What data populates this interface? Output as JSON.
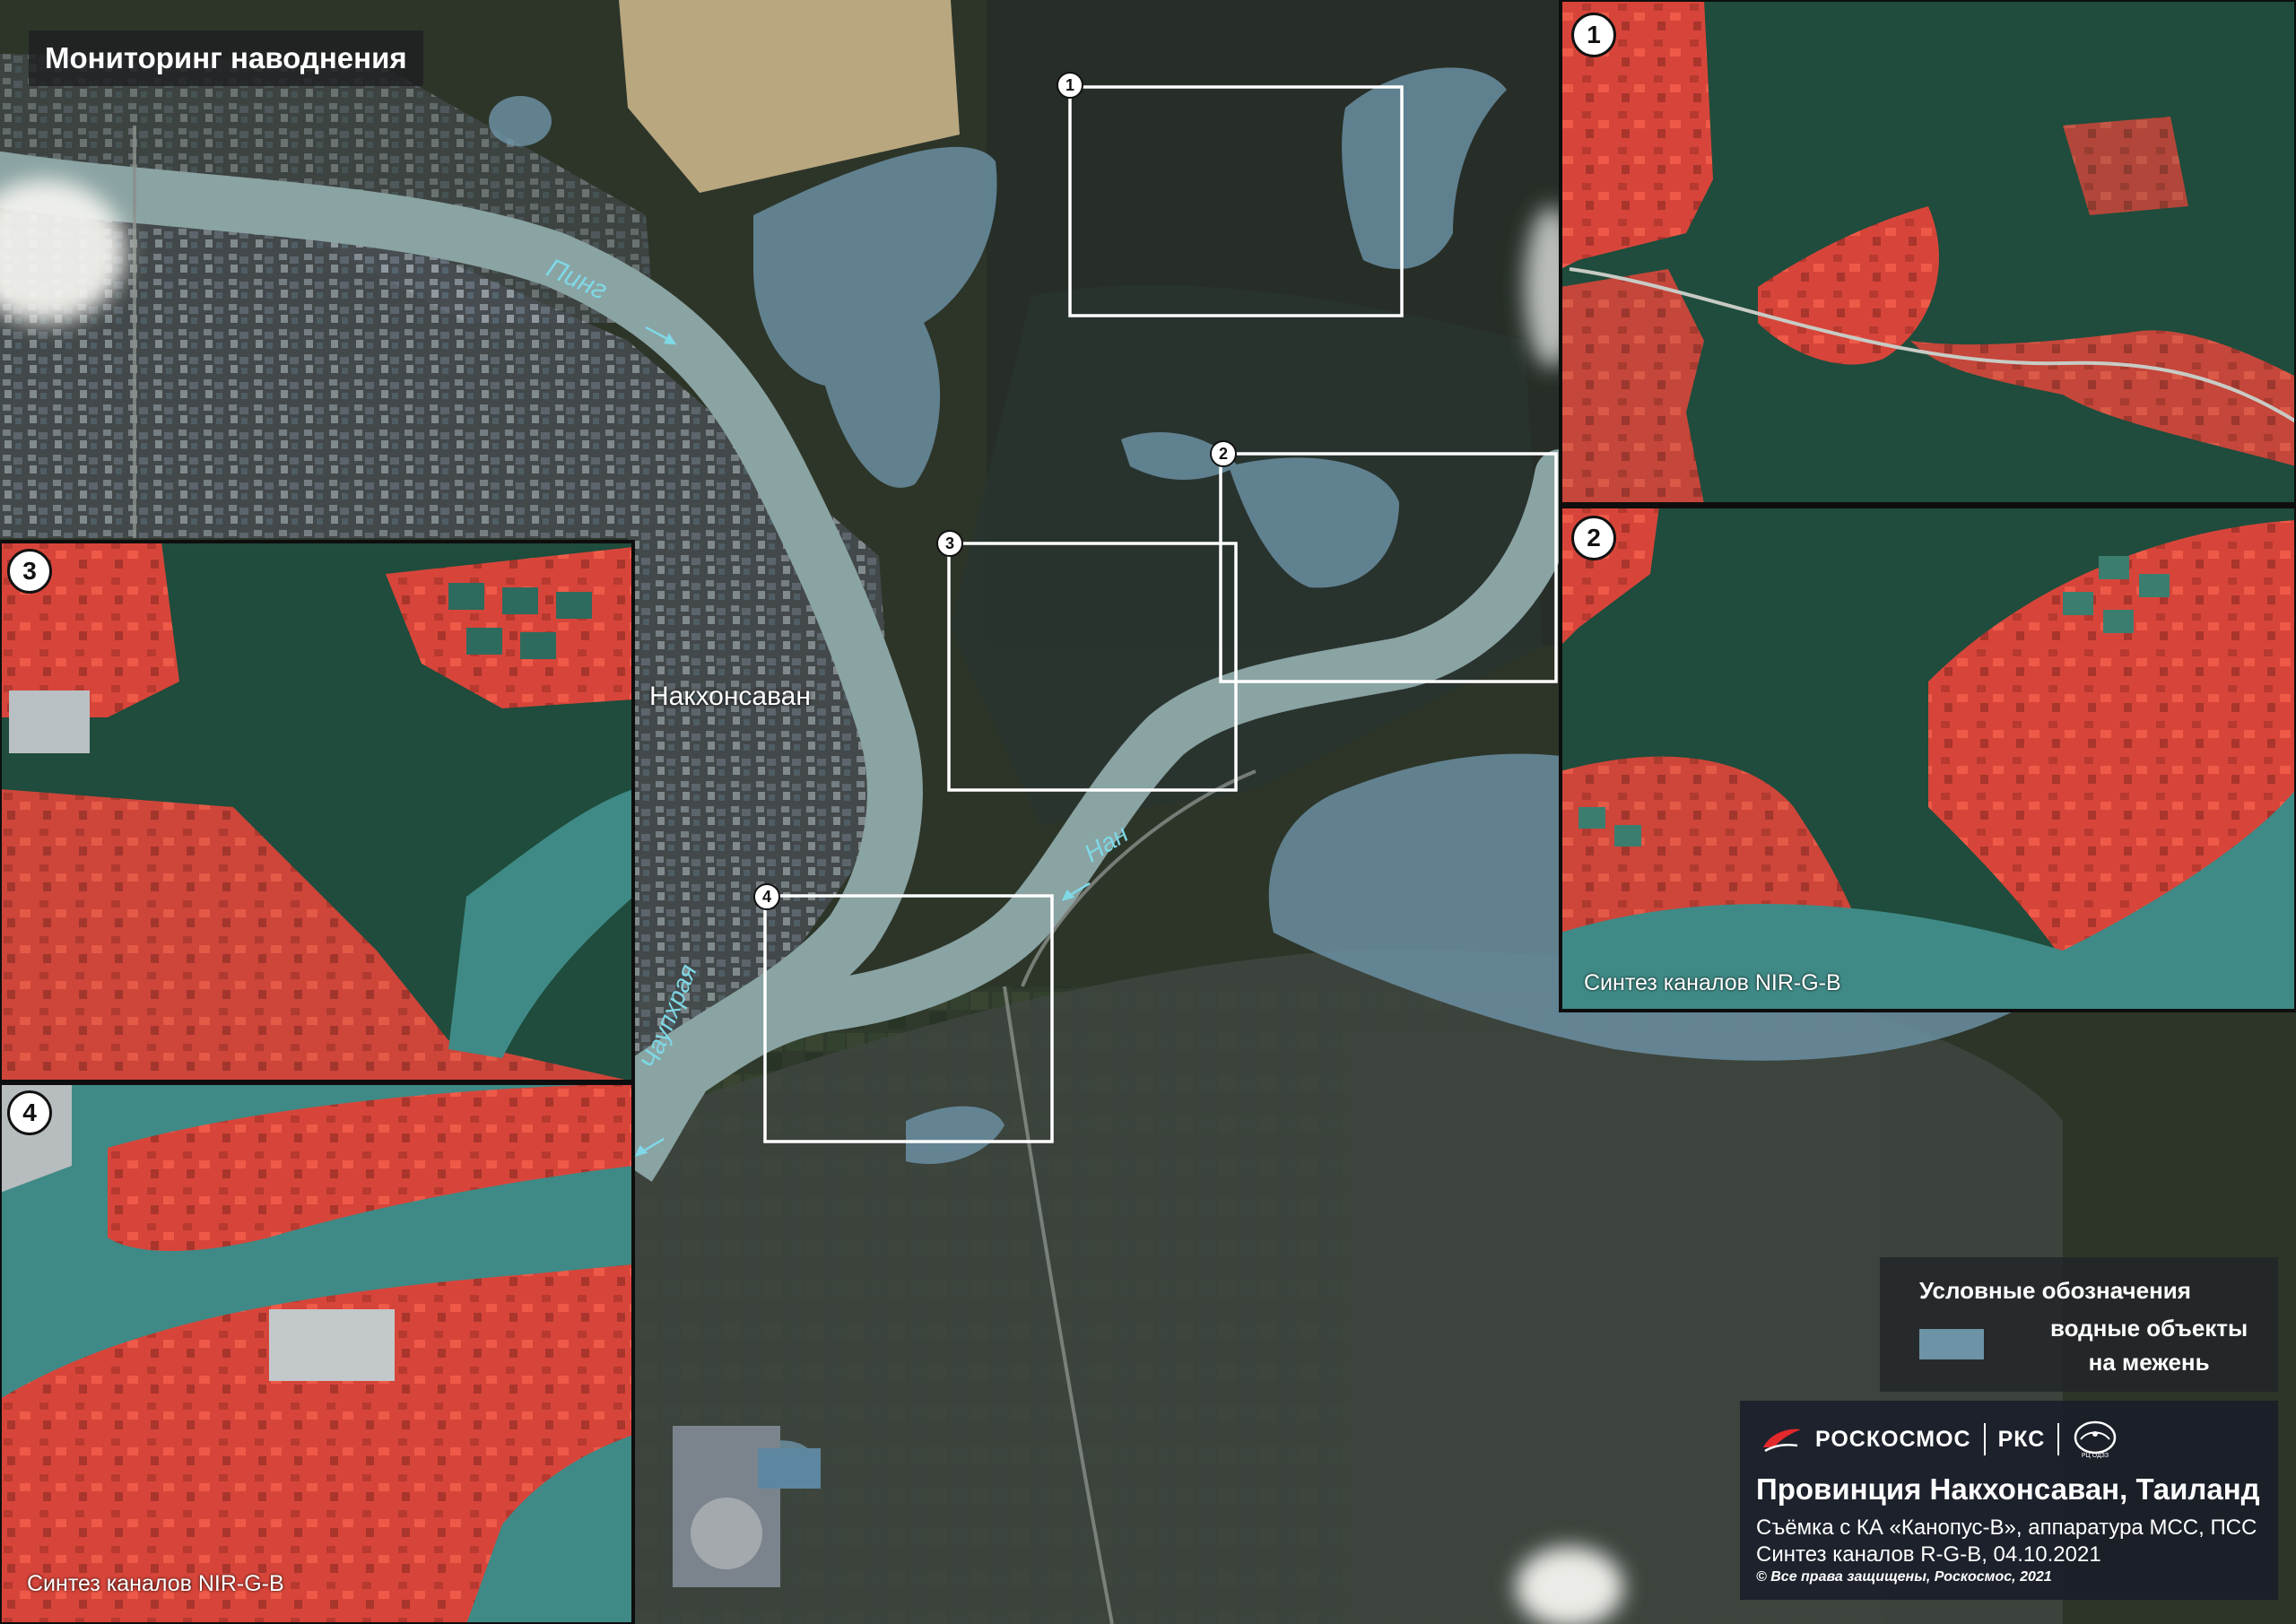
{
  "title": "Мониторинг наводнения",
  "place_label": "Накхонсаван",
  "rivers": [
    {
      "name": "Пинг",
      "arrow": "→"
    },
    {
      "name": "Нан",
      "arrow": "←"
    },
    {
      "name": "Чаупхрая",
      "arrow": "←"
    }
  ],
  "frames": [
    "1",
    "2",
    "3",
    "4"
  ],
  "insets": [
    {
      "number": "1"
    },
    {
      "number": "2",
      "caption": "Синтез каналов NIR-G-B"
    },
    {
      "number": "3"
    },
    {
      "number": "4",
      "caption": "Синтез каналов NIR-G-B"
    }
  ],
  "legend": {
    "title": "Условные обозначения",
    "item_label_line1": "водные объекты",
    "item_label_line2": "на межень",
    "swatch_color": "#6d93a6"
  },
  "info": {
    "brand_1": "РОСКОСМОС",
    "brand_2": "РКС",
    "emblem_text": "РЦ ОДЗЗ",
    "title": "Провинция Накхонсаван, Таиланд",
    "line1": "Съёмка с КА «Канопус-В», аппаратура МСС, ПСС",
    "line2": "Синтез каналов R-G-B, 04.10.2021",
    "copyright": "©  Все права защищены, Роскосмос, 2021"
  },
  "colors": {
    "land_dark": "#2c3a2a",
    "river": "#8aa3a3",
    "lowwater": "#6d93a6",
    "nir_red": "#e2473a",
    "nir_green": "#1f4c3c",
    "nir_water": "#3f8a86",
    "frame": "#ffffff"
  },
  "icons": [
    "roscosmos-logo-icon",
    "emblem-icon",
    "arrow-icon"
  ]
}
